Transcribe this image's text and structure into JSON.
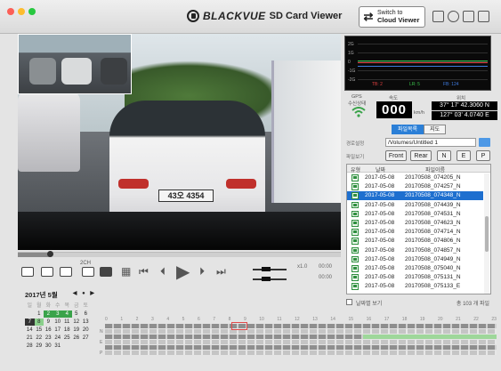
{
  "brand": {
    "name": "BLACKVUE",
    "product": "SD Card Viewer"
  },
  "cloud_button": {
    "line1": "Switch to",
    "line2": "Cloud Viewer",
    "arrow": "⇄"
  },
  "controls": {
    "channel_label": "2CH",
    "speed_label": "x1.0",
    "time_a": "00:00",
    "time_b": "00:00"
  },
  "video": {
    "plate": "43오 4354",
    "progress": 0.1
  },
  "calendar": {
    "title": "2017년 5월",
    "nav_prev": "◀",
    "nav_dot": "●",
    "nav_next": "▶",
    "weekdays": [
      "일",
      "월",
      "화",
      "수",
      "목",
      "금",
      "토"
    ],
    "rows": [
      [
        "",
        "1",
        "2",
        "3",
        "4",
        "5",
        "6"
      ],
      [
        "7",
        "8",
        "9",
        "10",
        "11",
        "12",
        "13"
      ],
      [
        "14",
        "15",
        "16",
        "17",
        "18",
        "19",
        "20"
      ],
      [
        "21",
        "22",
        "23",
        "24",
        "25",
        "26",
        "27"
      ],
      [
        "28",
        "29",
        "30",
        "31",
        "",
        "",
        ""
      ]
    ]
  },
  "graph": {
    "ticks": [
      "2G",
      "1G",
      "0",
      "-1G",
      "-2G"
    ],
    "legend": [
      "TB: 2",
      "LR: 5",
      "FB: 124"
    ],
    "colors": {
      "tb": "#e04040",
      "lr": "#39c04a",
      "fb": "#3f7be0"
    }
  },
  "gps": {
    "label": "GPS",
    "sub": "수신상태",
    "speed_label": "속도",
    "speed_value": "000",
    "unit": "km/h",
    "loc_label": "위치",
    "lat": "37° 17' 42.3060 N",
    "lon": "127° 03' 4.0740 E"
  },
  "tabs": [
    {
      "label": "파일목록",
      "active": true
    },
    {
      "label": "지도",
      "active": false
    }
  ],
  "path": {
    "label": "경로설정",
    "value": "/Volumes/Untitled 1"
  },
  "filter": {
    "label": "파일보기",
    "front": "Front",
    "rear": "Rear",
    "n": "N",
    "e": "E",
    "p": "P"
  },
  "filelist": {
    "headers": {
      "type": "유형",
      "date": "날짜",
      "name": "파일이름"
    },
    "rows": [
      {
        "date": "2017-05-08",
        "name": "20170508_074205_N",
        "selected": false
      },
      {
        "date": "2017-05-08",
        "name": "20170508_074257_N",
        "selected": false
      },
      {
        "date": "2017-05-08",
        "name": "20170508_074348_N",
        "selected": true
      },
      {
        "date": "2017-05-08",
        "name": "20170508_074439_N",
        "selected": false
      },
      {
        "date": "2017-05-08",
        "name": "20170508_074531_N",
        "selected": false
      },
      {
        "date": "2017-05-08",
        "name": "20170508_074623_N",
        "selected": false
      },
      {
        "date": "2017-05-08",
        "name": "20170508_074714_N",
        "selected": false
      },
      {
        "date": "2017-05-08",
        "name": "20170508_074806_N",
        "selected": false
      },
      {
        "date": "2017-05-08",
        "name": "20170508_074857_N",
        "selected": false
      },
      {
        "date": "2017-05-08",
        "name": "20170508_074949_N",
        "selected": false
      },
      {
        "date": "2017-05-08",
        "name": "20170508_075040_N",
        "selected": false
      },
      {
        "date": "2017-05-08",
        "name": "20170508_075131_N",
        "selected": false
      },
      {
        "date": "2017-05-08",
        "name": "20170508_075133_E",
        "selected": false
      }
    ]
  },
  "footer": {
    "checkbox_label": "날짜별 보기",
    "count": "총 103 개 파일"
  },
  "timeline": {
    "hours": [
      "0",
      "1",
      "2",
      "3",
      "4",
      "5",
      "6",
      "7",
      "8",
      "9",
      "10",
      "11",
      "12",
      "13",
      "14",
      "15",
      "16",
      "17",
      "18",
      "19",
      "20",
      "21",
      "22",
      "23"
    ],
    "labels": [
      "N",
      "E",
      "P"
    ]
  }
}
